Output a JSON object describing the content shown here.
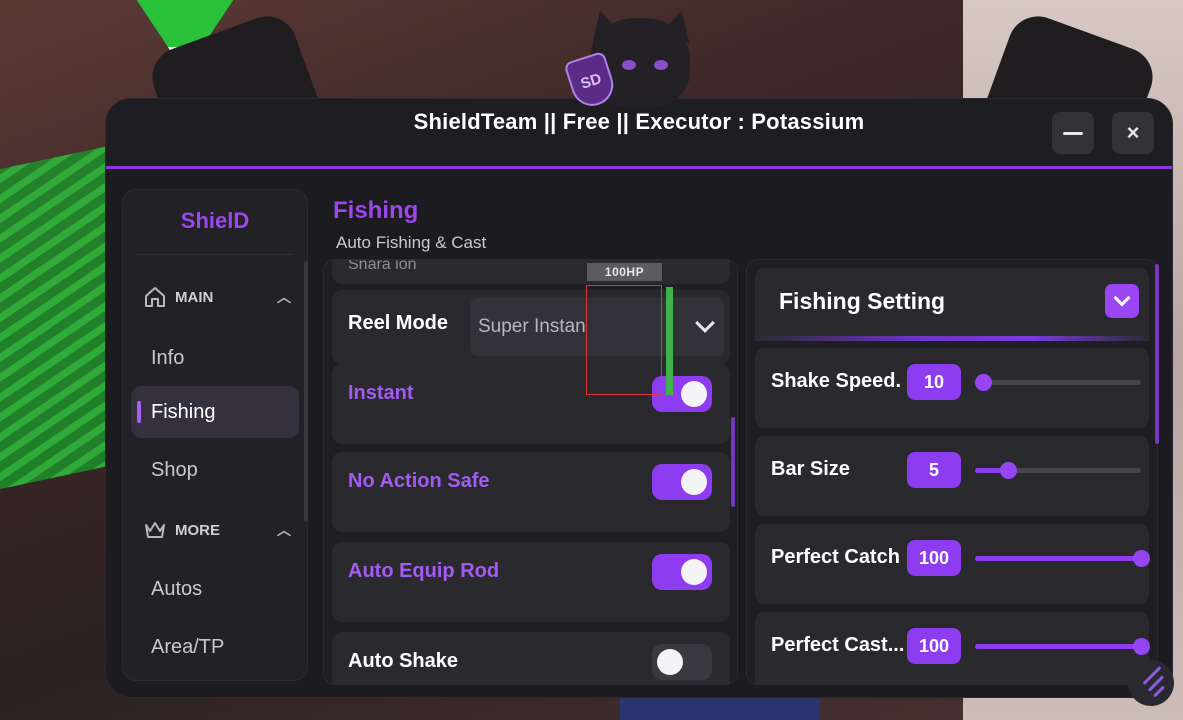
{
  "window": {
    "title": "ShieldTeam || Free || Executor : Potassium",
    "minimize_icon": "minimize-icon",
    "close_label": "×"
  },
  "mascot": {
    "badge_text": "SD"
  },
  "sidebar": {
    "brand": "ShielD",
    "sections": [
      {
        "label": "MAIN",
        "icon": "home-icon",
        "items": [
          "Info",
          "Fishing",
          "Shop"
        ]
      },
      {
        "label": "MORE",
        "icon": "crown-icon",
        "items": [
          "Autos",
          "Area/TP"
        ]
      }
    ],
    "active_item": "Fishing"
  },
  "page": {
    "title": "Fishing",
    "subtitle": "Auto Fishing & Cast"
  },
  "left_panel": {
    "partial_label": "Snara ion",
    "reel_mode": {
      "label": "Reel Mode",
      "value": "Super Instan"
    },
    "toggles": [
      {
        "label": "Instant",
        "on": true
      },
      {
        "label": "No Action Safe",
        "on": true
      },
      {
        "label": "Auto Equip Rod",
        "on": true
      },
      {
        "label": "Auto Shake",
        "on": false
      }
    ]
  },
  "right_panel": {
    "header": "Fishing Setting",
    "sliders": [
      {
        "label": "Shake Speed.",
        "value": "10",
        "fraction": 0.05
      },
      {
        "label": "Bar Size",
        "value": "5",
        "fraction": 0.2
      },
      {
        "label": "Perfect Catch",
        "value": "100",
        "fraction": 1.0
      },
      {
        "label": "Perfect Cast...",
        "value": "100",
        "fraction": 1.0
      }
    ]
  },
  "overlay": {
    "hp_label": "100HP"
  },
  "colors": {
    "accent": "#8e3cf0",
    "accent_text": "#a25cf2",
    "panel": "#1c1b1f",
    "card": "#2a292e",
    "hp_bar": "#3fb349"
  }
}
